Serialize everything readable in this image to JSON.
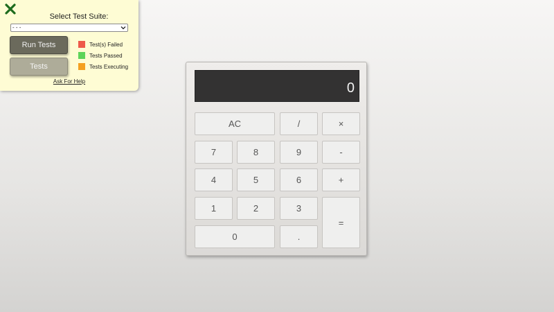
{
  "test_panel": {
    "title": "Select Test Suite:",
    "suite_select_value": "- - -",
    "run_tests_label": "Run Tests",
    "tests_label": "Tests",
    "legend": [
      {
        "label": "Test(s) Failed",
        "color": "#ee5a4a"
      },
      {
        "label": "Tests Passed",
        "color": "#5ed45a"
      },
      {
        "label": "Tests Executing",
        "color": "#f4a020"
      }
    ],
    "help_link": "Ask For Help",
    "close_icon_color": "#1d6b1d"
  },
  "calculator": {
    "display": "0",
    "keys": {
      "ac": "AC",
      "divide": "/",
      "multiply": "×",
      "seven": "7",
      "eight": "8",
      "nine": "9",
      "subtract": "-",
      "four": "4",
      "five": "5",
      "six": "6",
      "add": "+",
      "one": "1",
      "two": "2",
      "three": "3",
      "equals": "=",
      "zero": "0",
      "decimal": "."
    }
  }
}
